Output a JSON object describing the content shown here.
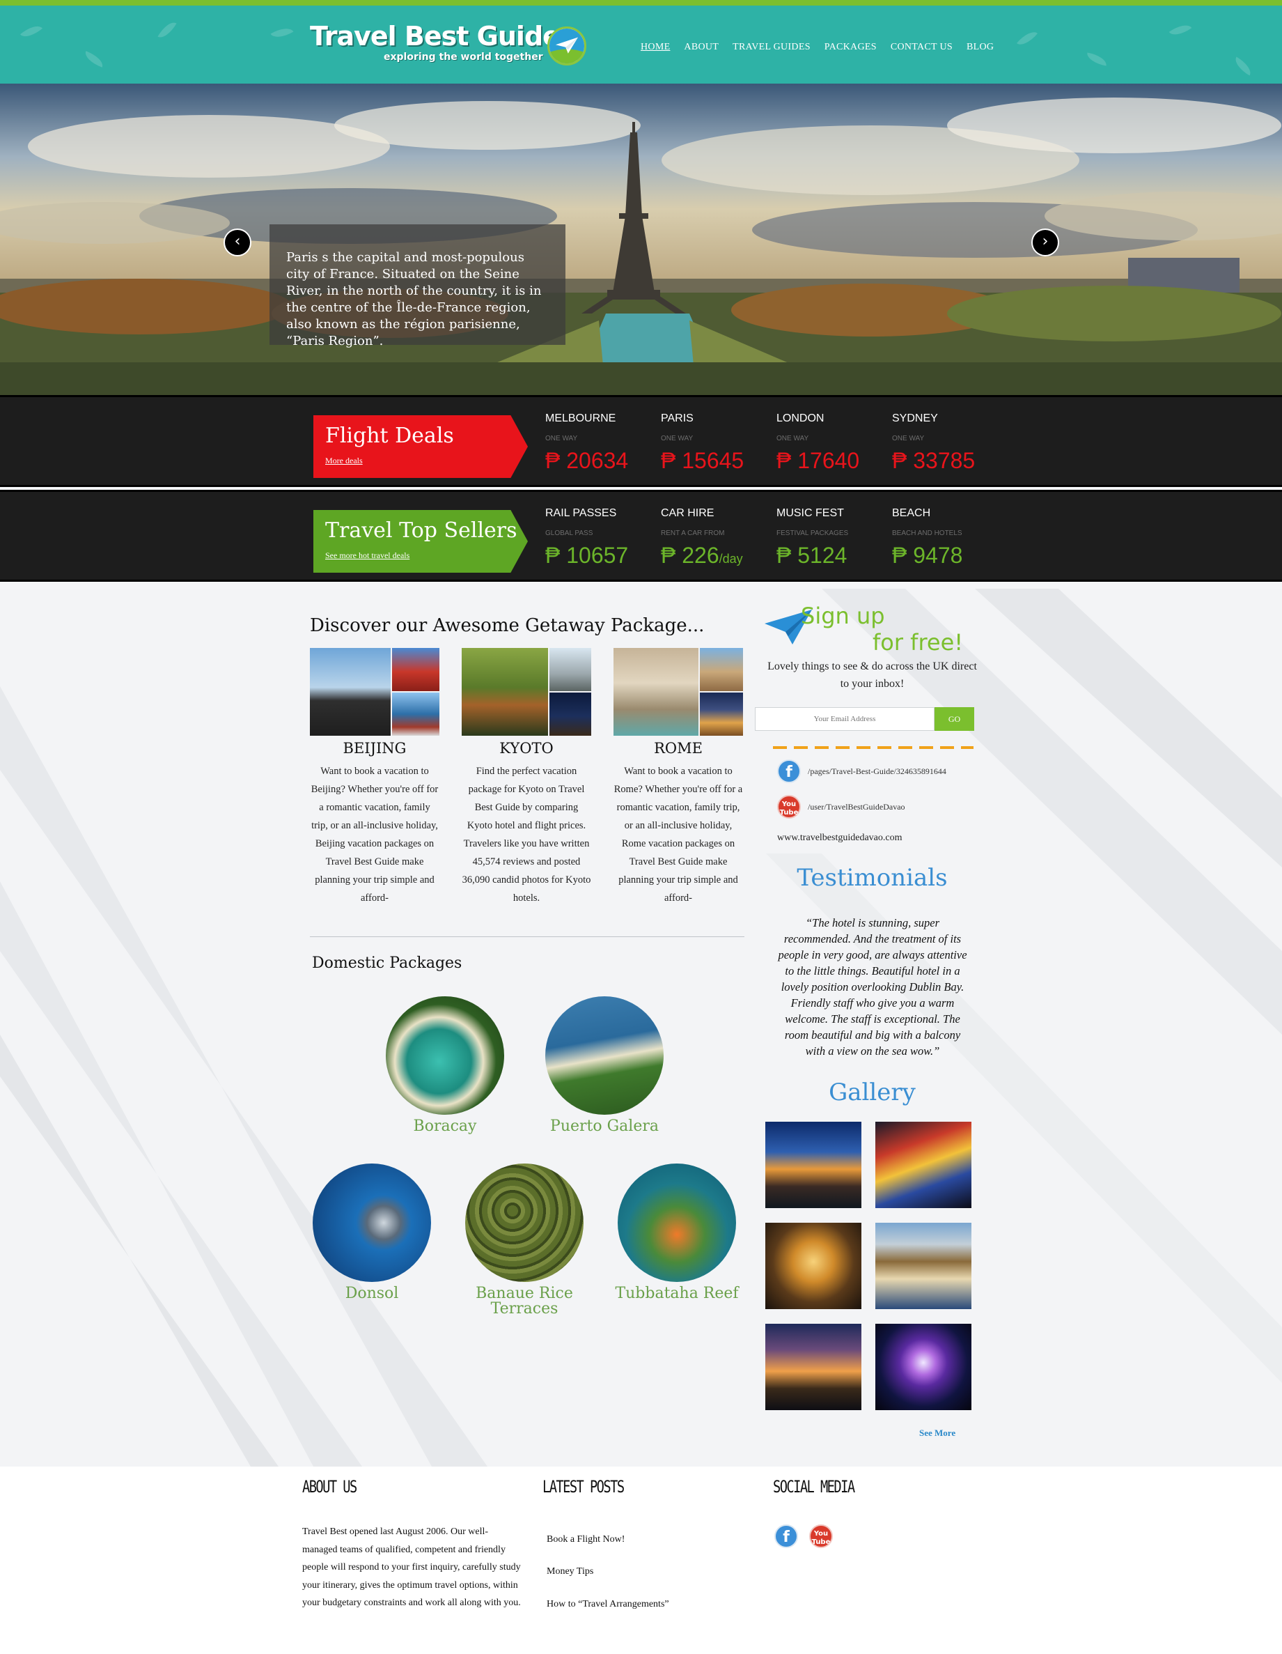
{
  "brand": {
    "title": "Travel Best Guide",
    "tagline": "exploring the world together",
    "accent": "#2eb2a6",
    "green": "#7bbf2e"
  },
  "nav": {
    "items": [
      "HOME",
      "ABOUT",
      "TRAVEL GUIDES",
      "PACKAGES",
      "CONTACT US",
      "BLOG"
    ],
    "active": "HOME"
  },
  "hero": {
    "caption": "Paris s the capital and most-populous city of France. Situated on the Seine River, in the north of the country, it is in the centre of the Île-de-France region, also known as the région parisienne, “Paris Region”.",
    "prev_icon": "chevron-left-icon",
    "next_icon": "chevron-right-icon"
  },
  "flight_deals": {
    "title": "Flight Deals",
    "link": "More deals",
    "color": "#e8141b",
    "items": [
      {
        "name": "MELBOURNE",
        "sub": "ONE WAY",
        "price": "₱ 20634",
        "unit": ""
      },
      {
        "name": "PARIS",
        "sub": "ONE WAY",
        "price": "₱ 15645",
        "unit": ""
      },
      {
        "name": "LONDON",
        "sub": "ONE WAY",
        "price": "₱ 17640",
        "unit": ""
      },
      {
        "name": "SYDNEY",
        "sub": "ONE WAY",
        "price": "₱ 33785",
        "unit": ""
      }
    ]
  },
  "top_sellers": {
    "title": "Travel Top Sellers",
    "link": "See more hot travel deals",
    "color": "#5ea624",
    "items": [
      {
        "name": "RAIL PASSES",
        "sub": "GLOBAL PASS",
        "price": "₱ 10657",
        "unit": ""
      },
      {
        "name": "CAR HIRE",
        "sub": "RENT A CAR FROM",
        "price": "₱ 226",
        "unit": "/day"
      },
      {
        "name": "MUSIC FEST",
        "sub": "FESTIVAL PACKAGES",
        "price": "₱ 5124",
        "unit": ""
      },
      {
        "name": "BEACH",
        "sub": "BEACH AND HOTELS",
        "price": "₱ 9478",
        "unit": ""
      }
    ]
  },
  "getaway": {
    "heading": "Discover our Awesome Getaway Package...",
    "packages": [
      {
        "name": "BEIJING",
        "desc": "Want to book a vacation to Beijing? Whether you're off for a romantic vacation, family trip, or an all-inclusive holiday, Beijing vacation packages on Travel Best Guide make planning your trip simple and afford-"
      },
      {
        "name": "KYOTO",
        "desc": "Find the perfect vacation package for Kyoto on Travel Best Guide by comparing Kyoto hotel and flight prices. Travelers like you have written 45,574 reviews and posted 36,090 candid photos for Kyoto hotels."
      },
      {
        "name": "ROME",
        "desc": "Want to book a vacation to Rome? Whether you're off for a romantic vacation, family trip, or an all-inclusive holiday, Rome vacation packages on Travel Best Guide make planning your trip simple and afford-"
      }
    ]
  },
  "domestic": {
    "heading": "Domestic Packages",
    "items": [
      "Boracay",
      "Puerto Galera",
      "Donsol",
      "Banaue Rice Terraces",
      "Tubbataha Reef"
    ]
  },
  "signup": {
    "title_line1": "Sign up",
    "title_line2": "for free!",
    "desc": "Lovely things to see & do across the UK direct to your inbox!",
    "email_placeholder": "Your Email Address",
    "go_label": "GO"
  },
  "social_links": {
    "facebook": "/pages/Travel-Best-Guide/324635891644",
    "youtube": "/user/TravelBestGuideDavao",
    "website": "www.travelbestguidedavao.com",
    "fb_icon": "facebook-icon",
    "yt_icon": "youtube-icon"
  },
  "testimonials": {
    "heading": "Testimonials",
    "quote": "“The hotel is stunning, super recommended. And the treatment of its people in very good, are always attentive to the little things. Beautiful hotel in a lovely position overlooking Dublin Bay. Friendly staff who give you a warm welcome. The staff is exceptional. The room beautiful and big with a balcony with a view on the sea wow.”"
  },
  "gallery": {
    "heading": "Gallery",
    "see_more": "See More"
  },
  "footer": {
    "about_heading": "ABOUT US",
    "about_text": "Travel Best opened last August 2006. Our well-managed teams of qualified, competent and friendly people will respond to your first inquiry, carefully study your itinerary, gives the optimum travel options, within your budgetary constraints and work all along with you.",
    "posts_heading": "LATEST POSTS",
    "posts": [
      "Book a Flight Now!",
      "Money Tips",
      "How to “Travel Arrangements”"
    ],
    "social_heading": "SOCIAL MEDIA"
  }
}
